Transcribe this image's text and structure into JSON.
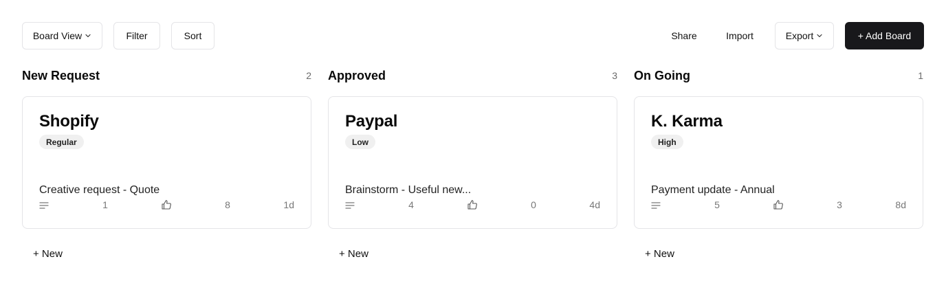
{
  "toolbar": {
    "view_select": {
      "label": "Board View",
      "icon": "chevron-down-icon"
    },
    "filter_label": "Filter",
    "sort_label": "Sort",
    "share_label": "Share",
    "import_label": "Import",
    "export_select": {
      "label": "Export",
      "icon": "chevron-down-icon"
    },
    "add_board_label": "+ Add Board"
  },
  "colors": {
    "primary": "#18181b",
    "border": "#e4e4e7",
    "badge_bg": "#f0f0f0",
    "muted_text": "#777777"
  },
  "columns": [
    {
      "title": "New Request",
      "count": "2",
      "new_label": "+ New",
      "cards": [
        {
          "title": "Shopify",
          "badge": "Regular",
          "description": "Creative request - Quote",
          "comments": "1",
          "likes": "8",
          "age": "1d"
        }
      ]
    },
    {
      "title": "Approved",
      "count": "3",
      "new_label": "+ New",
      "cards": [
        {
          "title": "Paypal",
          "badge": "Low",
          "description": "Brainstorm - Useful new...",
          "comments": "4",
          "likes": "0",
          "age": "4d"
        }
      ]
    },
    {
      "title": "On Going",
      "count": "1",
      "new_label": "+ New",
      "cards": [
        {
          "title": "K. Karma",
          "badge": "High",
          "description": "Payment update - Annual",
          "comments": "5",
          "likes": "3",
          "age": "8d"
        }
      ]
    }
  ]
}
